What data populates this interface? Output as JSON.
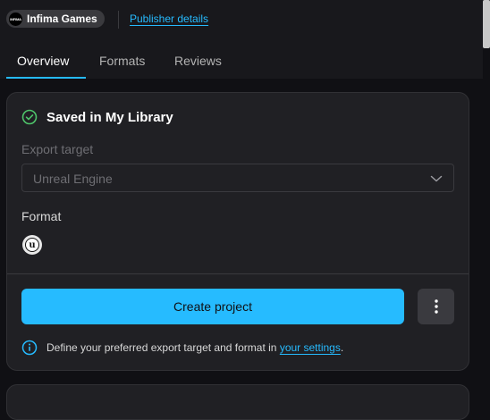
{
  "header": {
    "publisher_name": "Infima Games",
    "publisher_logo_text": "INFIMA",
    "publisher_link": "Publisher details"
  },
  "tabs": [
    {
      "label": "Overview",
      "active": true
    },
    {
      "label": "Formats",
      "active": false
    },
    {
      "label": "Reviews",
      "active": false
    }
  ],
  "library_card": {
    "status_title": "Saved in My Library",
    "export_target_label": "Export target",
    "export_target_value": "Unreal Engine",
    "format_label": "Format",
    "format_icon": "unreal-engine-icon",
    "format_icon_glyph": "u",
    "create_button_label": "Create project",
    "info_text": "Define your preferred export target and format in ",
    "info_link": "your settings",
    "info_suffix": "."
  },
  "colors": {
    "accent": "#26bbff",
    "success": "#4ec46a",
    "background": "#101014",
    "card": "#202024"
  }
}
